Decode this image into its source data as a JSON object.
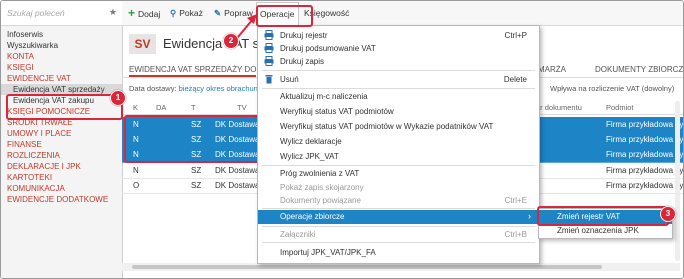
{
  "sidebar": {
    "search_placeholder": "Szukaj poleceń",
    "items": [
      {
        "label": "Infoserwis"
      },
      {
        "label": "Wyszukiwarka"
      },
      {
        "label": "KONTA"
      },
      {
        "label": "KSIĘGI"
      },
      {
        "label": "EWIDENCJE VAT"
      },
      {
        "label": "Ewidencja VAT sprzedaży"
      },
      {
        "label": "Ewidencja VAT zakupu"
      },
      {
        "label": "KSIĘGI POMOCNICZE"
      },
      {
        "label": "ŚRODKI TRWAŁE"
      },
      {
        "label": "UMOWY I PLACE"
      },
      {
        "label": "FINANSE"
      },
      {
        "label": "ROZLICZENIA"
      },
      {
        "label": "DEKLARACJE I JPK"
      },
      {
        "label": "KARTOTEKI"
      },
      {
        "label": "KOMUNIKACJA"
      },
      {
        "label": "EWIDENCJE DODATKOWE"
      }
    ]
  },
  "toolbar": {
    "dodaj": "Dodaj",
    "pokaz": "Pokaż",
    "popraw": "Popraw",
    "operacje": "Operacje",
    "ksiegowosc": "Księgowość"
  },
  "header": {
    "badge": "SV",
    "title": "Ewidencja VAT sprzedaży"
  },
  "tabs": {
    "first": "EWIDENCJA VAT SPRZEDAŻY DO",
    "marza": "MARŻA",
    "dokumenty": "DOKUMENTY ZBIORCZE"
  },
  "filter": {
    "prefix": "Data dostawy:",
    "link": "bieżący okres obrachunk",
    "right": "Wpływa na rozliczenie VAT (dowolny)"
  },
  "table": {
    "headers": {
      "k": "K",
      "da": "DA",
      "t": "T",
      "tv": "TV",
      "numer": "er dokumentu",
      "podmiot": "Podmiot"
    },
    "rows": [
      {
        "k": "N",
        "t": "SZ",
        "tv": "DK Dostawa",
        "podmiot": "Firma przykładowa sy..."
      },
      {
        "k": "N",
        "t": "SZ",
        "tv": "DK Dostawa",
        "podmiot": "Firma przykładowa sy..."
      },
      {
        "k": "N",
        "t": "SZ",
        "tv": "DK Dostawa",
        "podmiot": "Firma przykładowa sy..."
      },
      {
        "k": "N",
        "t": "SZ",
        "tv": "DK Dostawa",
        "podmiot": "Firma przykładowa sy..."
      },
      {
        "k": "O",
        "t": "SZ",
        "tv": "DK Dostawa",
        "podmiot": "Firma przykładowa sy..."
      }
    ]
  },
  "menu": {
    "drukuj_rejestr": "Drukuj rejestr",
    "drukuj_rejestr_sc": "Ctrl+P",
    "drukuj_podsumowanie": "Drukuj podsumowanie VAT",
    "drukuj_zapis": "Drukuj zapis",
    "usun": "Usuń",
    "usun_sc": "Delete",
    "aktualizuj": "Aktualizuj m-c naliczenia",
    "weryfikuj": "Weryfikuj status VAT podmiotów",
    "weryfikuj_wykaz": "Weryfikuj status VAT podmiotów w Wykazie podatników VAT",
    "wylicz_deklaracje": "Wylicz deklaracje",
    "wylicz_jpk": "Wylicz JPK_VAT",
    "prog": "Próg zwolnienia z VAT",
    "pokaz_zapis": "Pokaż zapis skojarzony",
    "dok_powiazane": "Dokumenty powiązane",
    "dok_powiazane_sc": "Ctrl+E",
    "operacje_zbiorcze": "Operacje zbiorcze",
    "zalaczniki": "Załączniki",
    "zalaczniki_sc": "Ctrl+B",
    "importuj": "Importuj JPK_VAT/JPK_FA"
  },
  "submenu": {
    "zmien_rejestr": "Zmień rejestr VAT",
    "zmien_oznaczenia": "Zmień oznaczenia JPK"
  },
  "annotations": {
    "one": "1",
    "two": "2",
    "three": "3"
  },
  "colors": {
    "accent_red": "#c0392b",
    "selection_blue": "#1d84c6",
    "annotation_red": "#d9263b"
  }
}
